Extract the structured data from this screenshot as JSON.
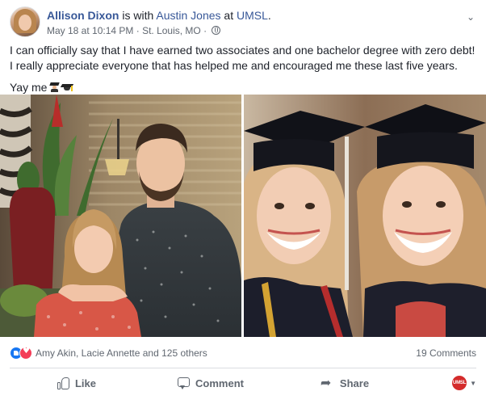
{
  "post": {
    "author": "Allison Dixon",
    "with_text": " is with ",
    "tagged": "Austin Jones",
    "at_text": " at ",
    "place": "UMSL",
    "period": ".",
    "timestamp": "May 18 at 10:14 PM",
    "separator1": " · ",
    "location": "St. Louis, MO",
    "separator2": " · ",
    "privacy_icon": "globe-icon",
    "body": "I can officially say that I have earned two associates and one bachelor degree with zero debt! I really appreciate everyone that has helped me and encouraged me these last five years.",
    "yay": "Yay me"
  },
  "photos": [
    {
      "name": "photo-couple",
      "description_icon": "photo"
    },
    {
      "name": "photo-graduation-selfie",
      "description_icon": "photo"
    }
  ],
  "reactions": {
    "names": "Amy Akin, Lacie Annette and 125 others",
    "comments": "19 Comments",
    "icons": [
      "like-icon",
      "love-icon"
    ]
  },
  "actions": {
    "like": "Like",
    "comment": "Comment",
    "share": "Share",
    "profile_badge": "UMSL"
  },
  "colors": {
    "link": "#385898",
    "meta": "#606770",
    "like_blue": "#1877f2",
    "love_red": "#f33e58"
  }
}
